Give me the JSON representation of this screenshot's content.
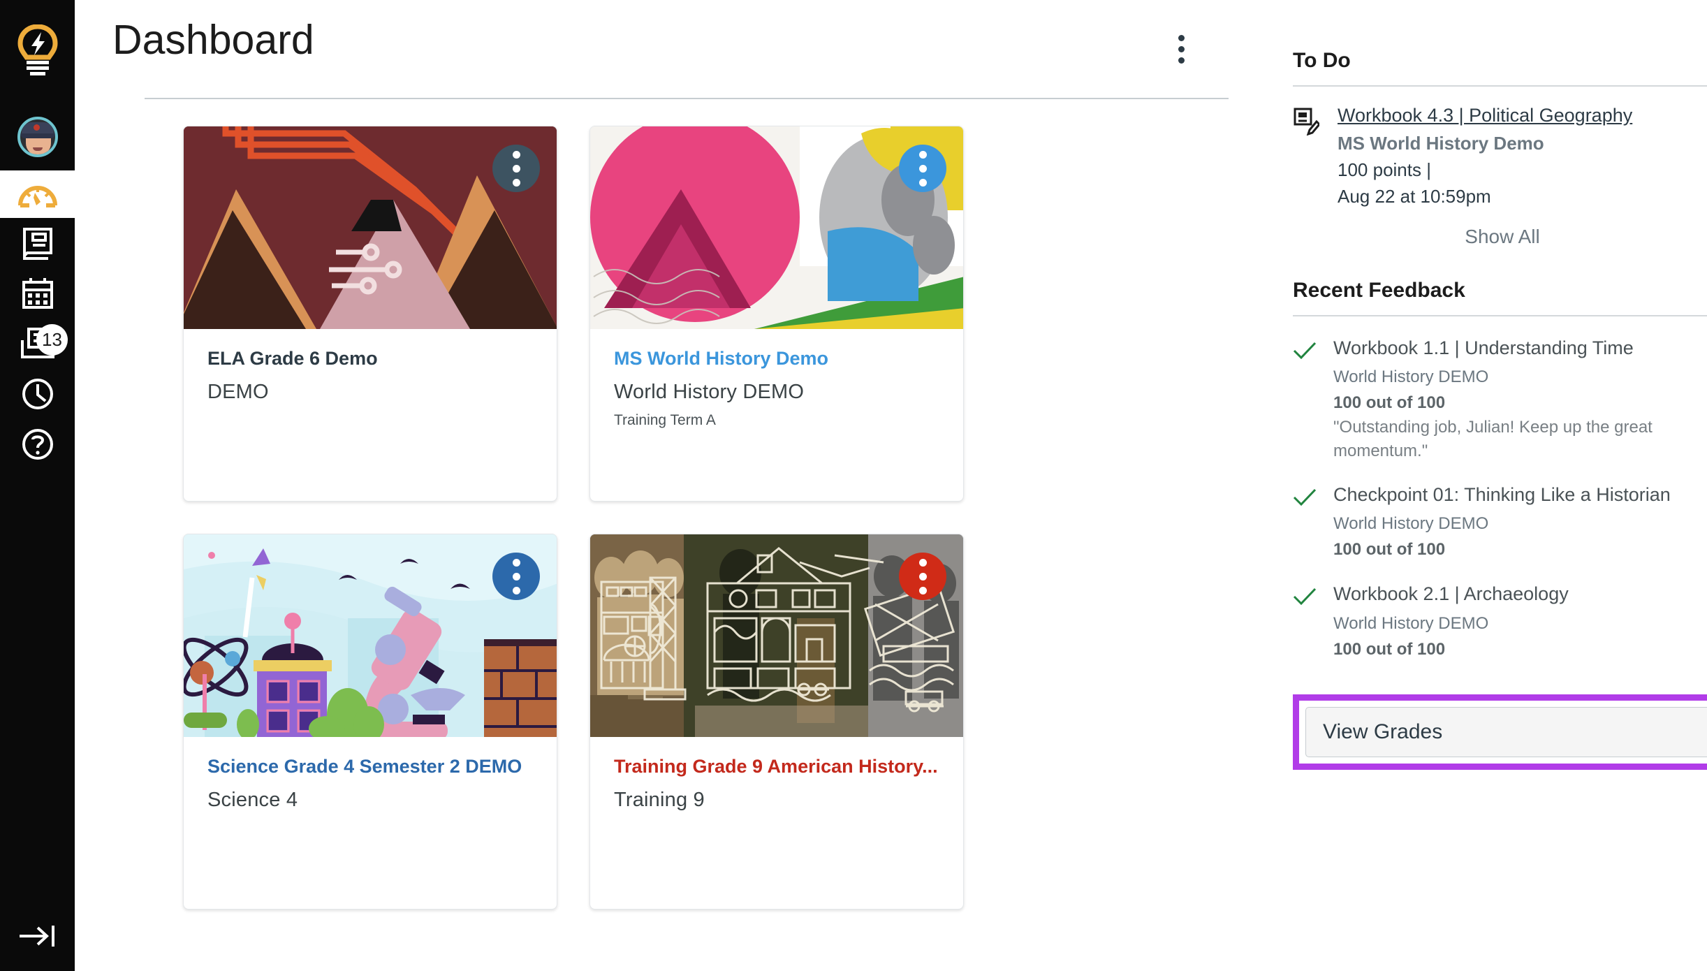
{
  "global_nav": {
    "logo_icon": "lightbulb-lightning-icon",
    "account_icon": "user-avatar",
    "items": [
      {
        "label": "Dashboard",
        "icon": "dashboard-gauge-icon",
        "active": true,
        "badge": null
      },
      {
        "label": "Courses",
        "icon": "book-icon",
        "active": false,
        "badge": null
      },
      {
        "label": "Calendar",
        "icon": "calendar-icon",
        "active": false,
        "badge": null
      },
      {
        "label": "Inbox",
        "icon": "inbox-icon",
        "active": false,
        "badge": "13"
      },
      {
        "label": "History",
        "icon": "clock-icon",
        "active": false,
        "badge": null
      },
      {
        "label": "Help",
        "icon": "question-circle-icon",
        "active": false,
        "badge": null
      }
    ],
    "collapse_icon": "arrow-to-line-right-icon"
  },
  "header": {
    "title": "Dashboard",
    "options_icon": "kebab-menu-icon"
  },
  "cards": [
    {
      "title": "ELA Grade 6 Demo",
      "title_color": "#2d3b45",
      "subtitle": "DEMO",
      "term": "",
      "kebab_color": "#3d5361",
      "kebab_icon": "kebab-menu-icon",
      "art": "art1"
    },
    {
      "title": "MS World History Demo",
      "title_color": "#3b96dc",
      "subtitle": "World History DEMO",
      "term": "Training Term A",
      "kebab_color": "#3b96dc",
      "kebab_icon": "kebab-menu-icon",
      "art": "art2"
    },
    {
      "title": "Science Grade 4 Semester 2 DEMO",
      "title_color": "#2c69ab",
      "subtitle": "Science 4",
      "term": "",
      "kebab_color": "#2c69ab",
      "kebab_icon": "kebab-menu-icon",
      "art": "art3"
    },
    {
      "title": "Training Grade 9 American History...",
      "title_color": "#c3291c",
      "subtitle": "Training 9",
      "term": "",
      "kebab_color": "#d02b17",
      "kebab_icon": "kebab-menu-icon",
      "art": "art4"
    }
  ],
  "sidebar": {
    "todo": {
      "heading": "To Do",
      "items": [
        {
          "icon": "assignment-edit-icon",
          "link": "Workbook 4.3 | Political Geography",
          "course": "MS World History Demo",
          "points": "100 points  |",
          "due": "Aug 22 at 10:59pm",
          "close_icon": "close-x-icon"
        }
      ],
      "show_all": "Show All"
    },
    "recent_feedback": {
      "heading": "Recent Feedback",
      "items": [
        {
          "icon": "check-icon",
          "title": "Workbook 1.1 | Understanding Time",
          "course": "World History DEMO",
          "score": "100 out of 100",
          "comment": "\"Outstanding job, Julian! Keep up the great momentum.\""
        },
        {
          "icon": "check-icon",
          "title": "Checkpoint 01: Thinking Like a Historian",
          "course": "World History DEMO",
          "score": "100 out of 100",
          "comment": ""
        },
        {
          "icon": "check-icon",
          "title": "Workbook 2.1 | Archaeology",
          "course": "World History DEMO",
          "score": "100 out of 100",
          "comment": ""
        }
      ]
    },
    "view_grades_button": "View Grades",
    "highlight_color": "#b13ce8"
  },
  "colors": {
    "nav_background": "#0a0a0a",
    "brand_accent": "#eeac3b",
    "check_green": "#21843f",
    "link_blue": "#3b96dc"
  }
}
